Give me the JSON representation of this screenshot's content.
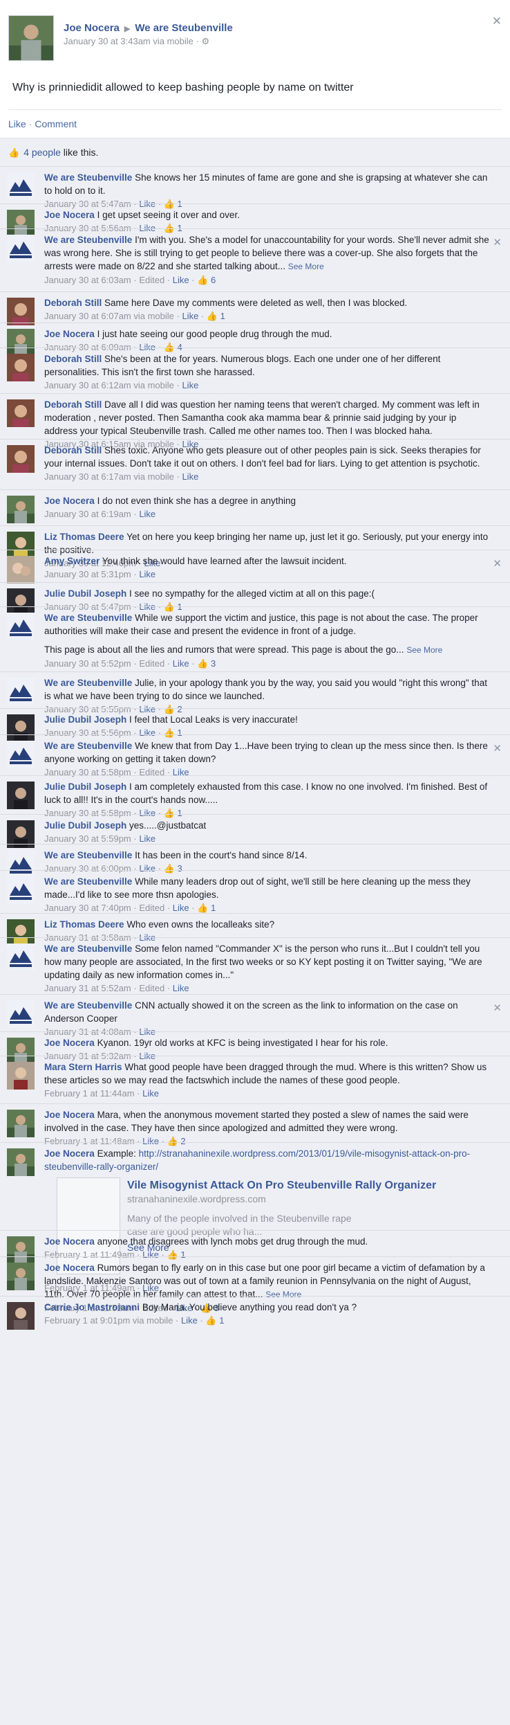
{
  "post": {
    "author": "Joe Nocera",
    "target": "We are Steubenville",
    "time": "January 30 at 3:43am via mobile",
    "text": "Why is prinniedidit allowed to keep bashing people by name on twitter",
    "actions": {
      "like": "Like",
      "comment": "Comment"
    },
    "likes": {
      "count_link": "4 people",
      "suffix": "like this."
    }
  },
  "comments": [
    {
      "author": "We are Steubenville",
      "avatar": "logo",
      "text": "She knows her 15 minutes of fame are gone and she is grapsing at whatever she can to hold on to it.",
      "time": "January 30 at 5:47am",
      "likes": "1"
    },
    {
      "author": "Joe Nocera",
      "avatar": "joe",
      "text": "I get upset seeing it over and over.",
      "time": "January 30 at 5:56am",
      "likes": "1"
    },
    {
      "author": "We are Steubenville",
      "avatar": "logo",
      "text": "I'm with you. She's a model for unaccountability for your words. She'll never admit she was wrong here. She is still trying to get people to believe there was a cover-up. She also forgets that the arrests were made on 8/22 and she started talking about...",
      "see_more": "See More",
      "time": "January 30 at 6:03am",
      "edited": "Edited",
      "likes": "6",
      "close": true
    },
    {
      "author": "Deborah Still",
      "avatar": "deb",
      "text": "Same here Dave my comments were deleted as well, then I was blocked.",
      "time": "January 30 at 6:07am via mobile",
      "likes": "1"
    },
    {
      "author": "Joe Nocera",
      "avatar": "joe",
      "text": "I just hate seeing our good people drug through the mud.",
      "time": "January 30 at 6:09am",
      "likes": "4"
    },
    {
      "author": "Deborah Still",
      "avatar": "deb",
      "text": "She's been at the for years. Numerous blogs. Each one under one of her different personalities. This isn't the first town she harassed.",
      "time": "January 30 at 6:12am via mobile"
    },
    {
      "author": "Deborah Still",
      "avatar": "deb",
      "text": "Dave all I did was question her naming teens that weren't charged. My comment was left in moderation , never posted. Then Samantha cook aka mamma bear & prinnie said judging by your ip address your typical Steubenville trash. Called me other names too. Then I was blocked haha.",
      "time": "January 30 at 6:15am via mobile"
    },
    {
      "author": "Deborah Still",
      "avatar": "deb",
      "text": "Shes toxic. Anyone who gets pleasure out of other peoples pain is sick. Seeks therapies for your internal issues. Don't take it out on others. I don't feel bad for liars. Lying to get attention is psychotic.",
      "time": "January 30 at 6:17am via mobile"
    },
    {
      "author": "Joe Nocera",
      "avatar": "joe",
      "text": "I do not even think she has a degree in anything",
      "time": "January 30 at 6:19am"
    },
    {
      "author": "Liz Thomas Deere",
      "avatar": "liz",
      "text": "Yet on here you keep bringing her name up, just let it go. Seriously, put your energy into the positive.",
      "time": "January 30 at 12:46pm"
    },
    {
      "author": "Amy Switzer",
      "avatar": "amy",
      "text": "You think she would have learned after the lawsuit incident.",
      "time": "January 30 at 5:31pm",
      "close": true
    },
    {
      "author": "Julie Dubil Joseph",
      "avatar": "julie",
      "text": "I see no sympathy for the alleged victim at all on this page:(",
      "time": "January 30 at 5:47pm",
      "likes": "1"
    },
    {
      "author": "We are Steubenville",
      "avatar": "logo",
      "text": "While we support the victim and justice, this page is not about the case. The proper authorities will make their case and present the evidence in front of a judge.",
      "text2": "This page is about all the lies and rumors that were spread. This page is about the go...",
      "see_more": "See More",
      "time": "January 30 at 5:52pm",
      "edited": "Edited",
      "likes": "3"
    },
    {
      "author": "We are Steubenville",
      "avatar": "logo",
      "text": "Julie, in your apology thank you by the way, you said you would \"right this wrong\" that is what we have been trying to do since we launched.",
      "time": "January 30 at 5:55pm",
      "likes": "2"
    },
    {
      "author": "Julie Dubil Joseph",
      "avatar": "julie",
      "text": "I feel that Local Leaks is very inaccurate!",
      "time": "January 30 at 5:56pm",
      "likes": "1"
    },
    {
      "author": "We are Steubenville",
      "avatar": "logo",
      "text": "We knew that from Day 1...Have been trying to clean up the mess since then. Is there anyone working on getting it taken down?",
      "time": "January 30 at 5:58pm",
      "edited": "Edited",
      "close": true
    },
    {
      "author": "Julie Dubil Joseph",
      "avatar": "julie",
      "text": "I am completely exhausted from this case. I know no one involved. I'm finished. Best of luck to all!! It's in the court's hands now.....",
      "time": "January 30 at 5:58pm",
      "likes": "1"
    },
    {
      "author": "Julie Dubil Joseph",
      "avatar": "julie",
      "text": "yes.....@justbatcat",
      "time": "January 30 at 5:59pm"
    },
    {
      "author": "We are Steubenville",
      "avatar": "logo",
      "text": "It has been in the court's hand since 8/14.",
      "time": "January 30 at 6:00pm",
      "likes": "3"
    },
    {
      "author": "We are Steubenville",
      "avatar": "logo",
      "text": "While many leaders drop out of sight, we'll still be here cleaning up the mess they made...I'd like to see more thsn apologies.",
      "time": "January 30 at 7:40pm",
      "edited": "Edited",
      "likes": "1"
    },
    {
      "author": "Liz Thomas Deere",
      "avatar": "liz",
      "text": "Who even owns the localleaks site?",
      "time": "January 31 at 3:58am"
    },
    {
      "author": "We are Steubenville",
      "avatar": "logo",
      "text": "Some felon named \"Commander X\" is the person who runs it...But I couldn't tell you how many people are associated, In the first two weeks or so KY kept posting it on Twitter saying, \"We are updating daily as new information comes in...\"",
      "time": "January 31 at 5:52am",
      "edited": "Edited"
    },
    {
      "author": "We are Steubenville",
      "avatar": "logo",
      "text": "CNN actually showed it on the screen as the link to information on the case on Anderson Cooper",
      "time": "January 31 at 4:08am",
      "close": true
    },
    {
      "author": "Joe Nocera",
      "avatar": "joe",
      "text": "Kyanon. 19yr old works at KFC is being investigated I hear for his role.",
      "time": "January 31 at 5:32am"
    },
    {
      "author": "Mara Stern Harris",
      "avatar": "mara",
      "text": "What good people have been dragged through the mud. Where is this written? Show us these articles so we may read the factswhich include the names of these good people.",
      "time": "February 1 at 11:44am"
    },
    {
      "author": "Joe Nocera",
      "avatar": "joe",
      "text": "Mara, when the anonymous movement started they posted a slew of names the said were involved in the case. They have then since apologized and admitted they were wrong.",
      "time": "February 1 at 11:48am",
      "likes": "2"
    },
    {
      "author": "Joe Nocera",
      "avatar": "joe",
      "text": "Example:",
      "link": "http://stranahaninexile.wordpress.com/2013/01/19/vile-misogynist-attack-on-pro-steubenville-rally-organizer/",
      "share": {
        "title": "Vile Misogynist Attack On Pro Steubenville Rally Organizer",
        "domain": "stranahaninexile.wordpress.com",
        "desc": "Many of the people involved in the Steubenville rape case are good people who ha...",
        "more": "See More"
      },
      "time": "February 1 at 11:49am"
    },
    {
      "author": "Joe Nocera",
      "avatar": "joe",
      "text": "anyone that disagrees with lynch mobs get drug through the mud.",
      "time": "February 1 at 11:49am",
      "likes": "1"
    },
    {
      "author": "Joe Nocera",
      "avatar": "joe",
      "text": "Rumors began to fly early on in this case but one poor girl became a victim of defamation by a landslide. Makenzie Santoro was out of town at a family reunion in Pennsylvania on the night of August, 11th. Over 70 people in her family can attest to that...",
      "see_more": "See More",
      "time": "February 1 at 11:52am",
      "edited": "Edited",
      "likes": "3"
    },
    {
      "author": "Carrie Jo Mastroianni",
      "avatar": "carrie",
      "text": "Boy Maria. You believe anything you read don't ya ?",
      "time": "February 1 at 9:01pm via mobile",
      "likes": "1"
    }
  ],
  "ui": {
    "like_label": "Like",
    "thumb_icon": "thumb-up-icon",
    "close_icon": "close-icon"
  },
  "colors": {
    "link": "#3b5998",
    "meta": "#90949c",
    "feedback_bg": "#edeff4"
  }
}
